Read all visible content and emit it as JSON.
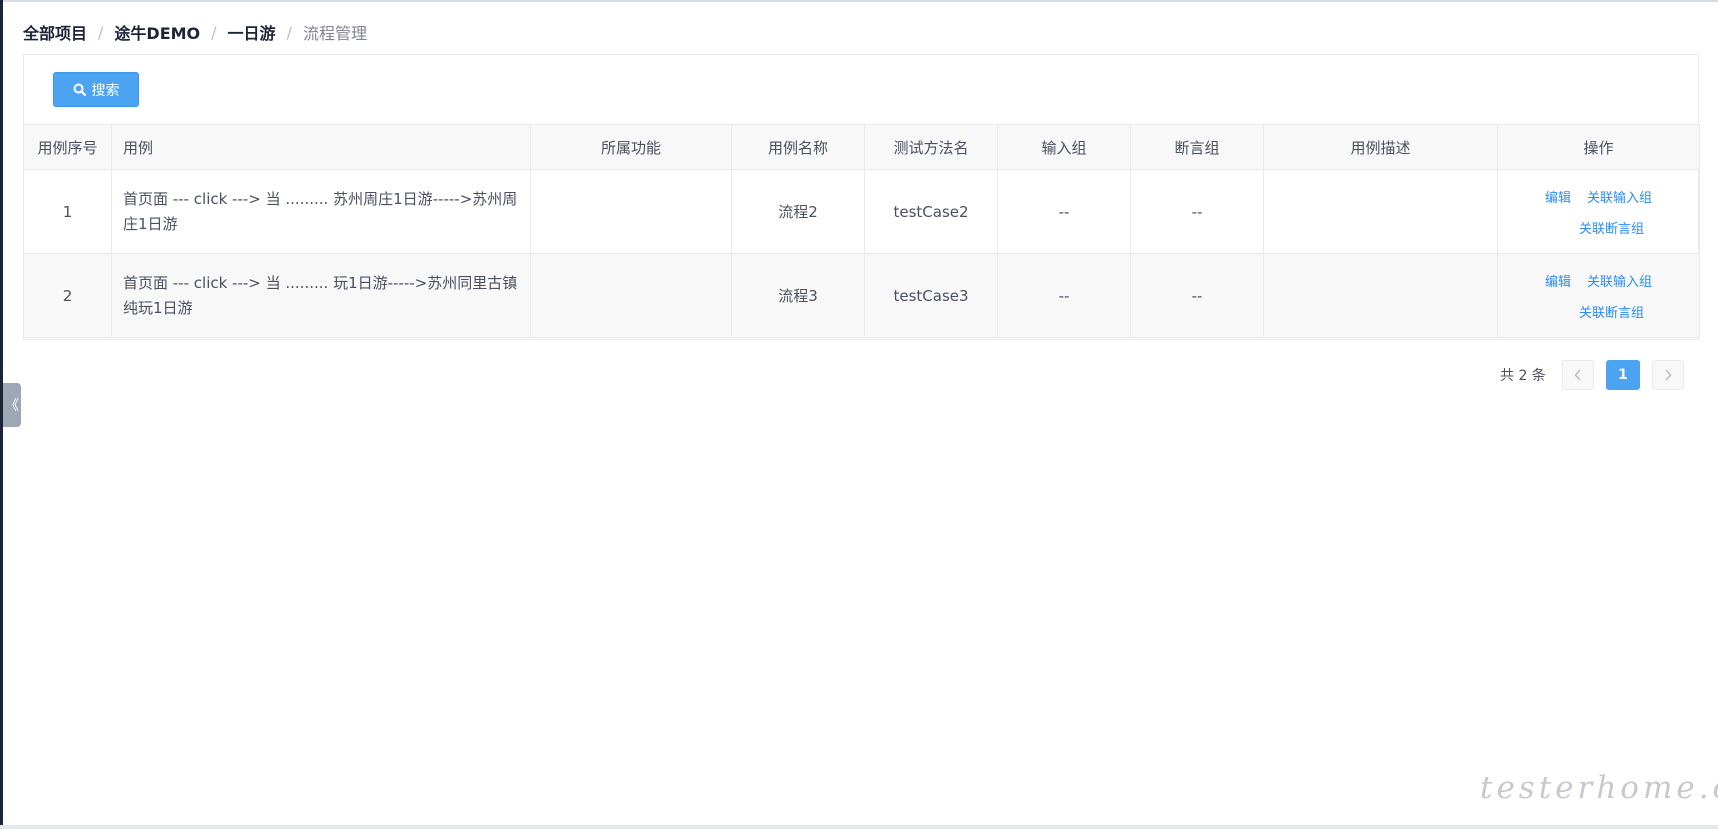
{
  "breadcrumb": {
    "items": [
      "全部项目",
      "途牛DEMO",
      "一日游"
    ],
    "current": "流程管理",
    "separator": "/"
  },
  "toolbar": {
    "search_label": "搜索",
    "search_icon": "search-icon"
  },
  "table": {
    "headers": [
      "用例序号",
      "用例",
      "所属功能",
      "用例名称",
      "测试方法名",
      "输入组",
      "断言组",
      "用例描述",
      "操作"
    ],
    "rows": [
      {
        "index": "1",
        "case": "首页面 --- click ---> 当 ......... 苏州周庄1日游----->苏州周庄1日游",
        "function": "",
        "name": "流程2",
        "method": "testCase2",
        "input_group": "--",
        "assert_group": "--",
        "description": "",
        "actions": {
          "edit": "编辑",
          "link_input": "关联输入组",
          "link_assert": "关联断言组"
        }
      },
      {
        "index": "2",
        "case": "首页面 --- click ---> 当 ......... 玩1日游----->苏州同里古镇纯玩1日游",
        "function": "",
        "name": "流程3",
        "method": "testCase3",
        "input_group": "--",
        "assert_group": "--",
        "description": "",
        "actions": {
          "edit": "编辑",
          "link_input": "关联输入组",
          "link_assert": "关联断言组"
        }
      }
    ]
  },
  "pagination": {
    "total_text": "共 2 条",
    "current_page": "1",
    "prev_icon": "chevron-left-icon",
    "next_icon": "chevron-right-icon"
  },
  "sidebar_toggle": {
    "icon": "double-chevron-left-icon",
    "glyph": "《"
  },
  "watermark": "testerhome.com",
  "colors": {
    "primary": "#4ba3f1",
    "link": "#2d8cf0",
    "header_bg": "#f8f8f9",
    "border": "#e9eaec",
    "text": "#495060"
  }
}
